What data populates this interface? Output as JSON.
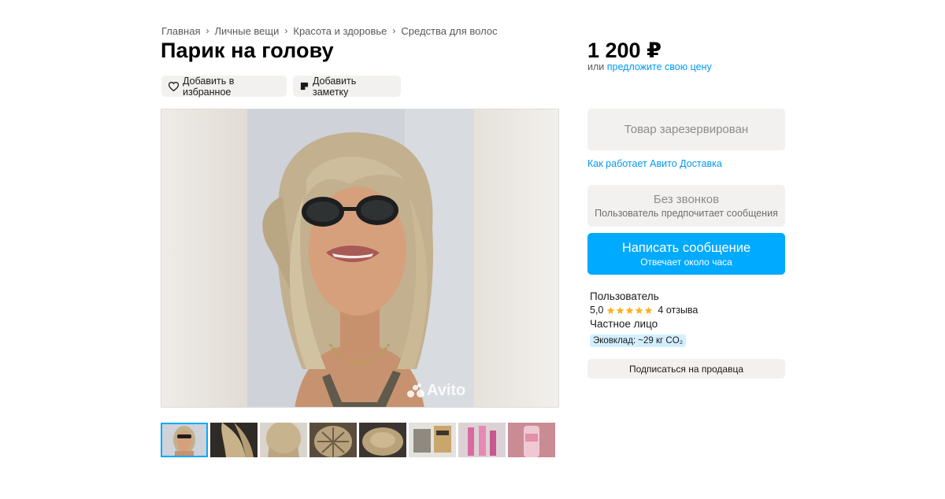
{
  "breadcrumbs": [
    "Главная",
    "Личные вещи",
    "Красота и здоровье",
    "Средства для волос"
  ],
  "title": "Парик на голову",
  "actions": {
    "favorite_label": "Добавить в избранное",
    "note_label": "Добавить заметку"
  },
  "gallery": {
    "watermark": "Avito",
    "thumbnail_count": 8,
    "active_index": 0
  },
  "price": {
    "value": "1 200 ₽",
    "offer_prefix": "или",
    "offer_link": "предложите свою цену"
  },
  "sidebar": {
    "reserved_label": "Товар зарезервирован",
    "delivery_link": "Как работает Авито Доставка",
    "no_calls_title": "Без звонков",
    "no_calls_subtitle": "Пользователь предпочитает сообщения",
    "message_title": "Написать сообщение",
    "message_subtitle": "Отвечает около часа"
  },
  "seller": {
    "name": "Пользователь",
    "rating": "5,0",
    "stars": 5,
    "reviews": "4 отзыва",
    "type": "Частное лицо",
    "eco": "Эковклад: ~29 кг CO₂",
    "subscribe_label": "Подписаться на продавца"
  },
  "colors": {
    "accent": "#00aaff",
    "link": "#0099f7",
    "star": "#ffb021",
    "button_gray": "#f2f1f0"
  }
}
